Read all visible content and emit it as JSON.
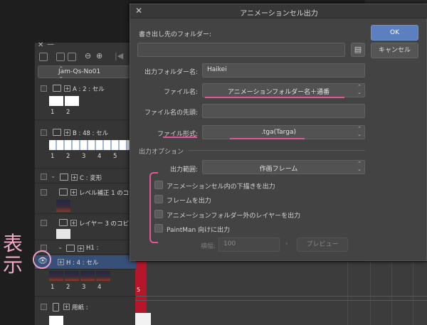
{
  "dialog": {
    "title": "アニメーションセル出力",
    "destination_label": "書き出し先のフォルダー:",
    "output_folder_label": "出力フォルダー名:",
    "output_folder_value": "Haikei",
    "file_name_label": "ファイル名:",
    "file_name_value": "アニメーションフォルダー名＋通番",
    "file_prefix_label": "ファイル名の先頭:",
    "file_prefix_value": "",
    "file_format_label": "ファイル形式:",
    "file_format_value": ".tga(Targa)",
    "output_options_label": "出力オプション",
    "output_range_label": "出力範囲:",
    "output_range_value": "作画フレーム",
    "checkboxes": [
      {
        "label": "アニメーションセル内の下描きを出力",
        "checked": false
      },
      {
        "label": "フレームを出力",
        "checked": false
      },
      {
        "label": "アニメーションフォルダー外のレイヤーを出力",
        "checked": false
      },
      {
        "label": "PaintMan 向けに出力",
        "checked": false
      }
    ],
    "width_label": "横幅:",
    "width_value": "100",
    "preview_label": "プレビュー",
    "ok_label": "OK",
    "cancel_label": "キャンセル"
  },
  "layer_panel": {
    "combo_value": "Jam-Qs-No01",
    "layers": [
      {
        "name": "A : 2 : セル",
        "frames": [
          "1",
          "2"
        ]
      },
      {
        "name": "B : 48 : セル",
        "frames": [
          "1",
          "2",
          "3",
          "4",
          "5"
        ]
      },
      {
        "name": "C : 変形"
      },
      {
        "name": "レベル補正 1 のコピー"
      },
      {
        "name": "レイヤー 3 のコピー2"
      },
      {
        "name": "H1 :"
      },
      {
        "name": "H : 4 : セル",
        "frames": [
          "1",
          "2",
          "3",
          "4"
        ]
      },
      {
        "name": "用紙 :"
      }
    ]
  },
  "timeline": {
    "frame_marker": "5"
  },
  "annotation": {
    "text": "表示"
  },
  "colors": {
    "accent": "#5b7fbf",
    "highlight": "#e0589a",
    "selected_row": "#37507a"
  }
}
